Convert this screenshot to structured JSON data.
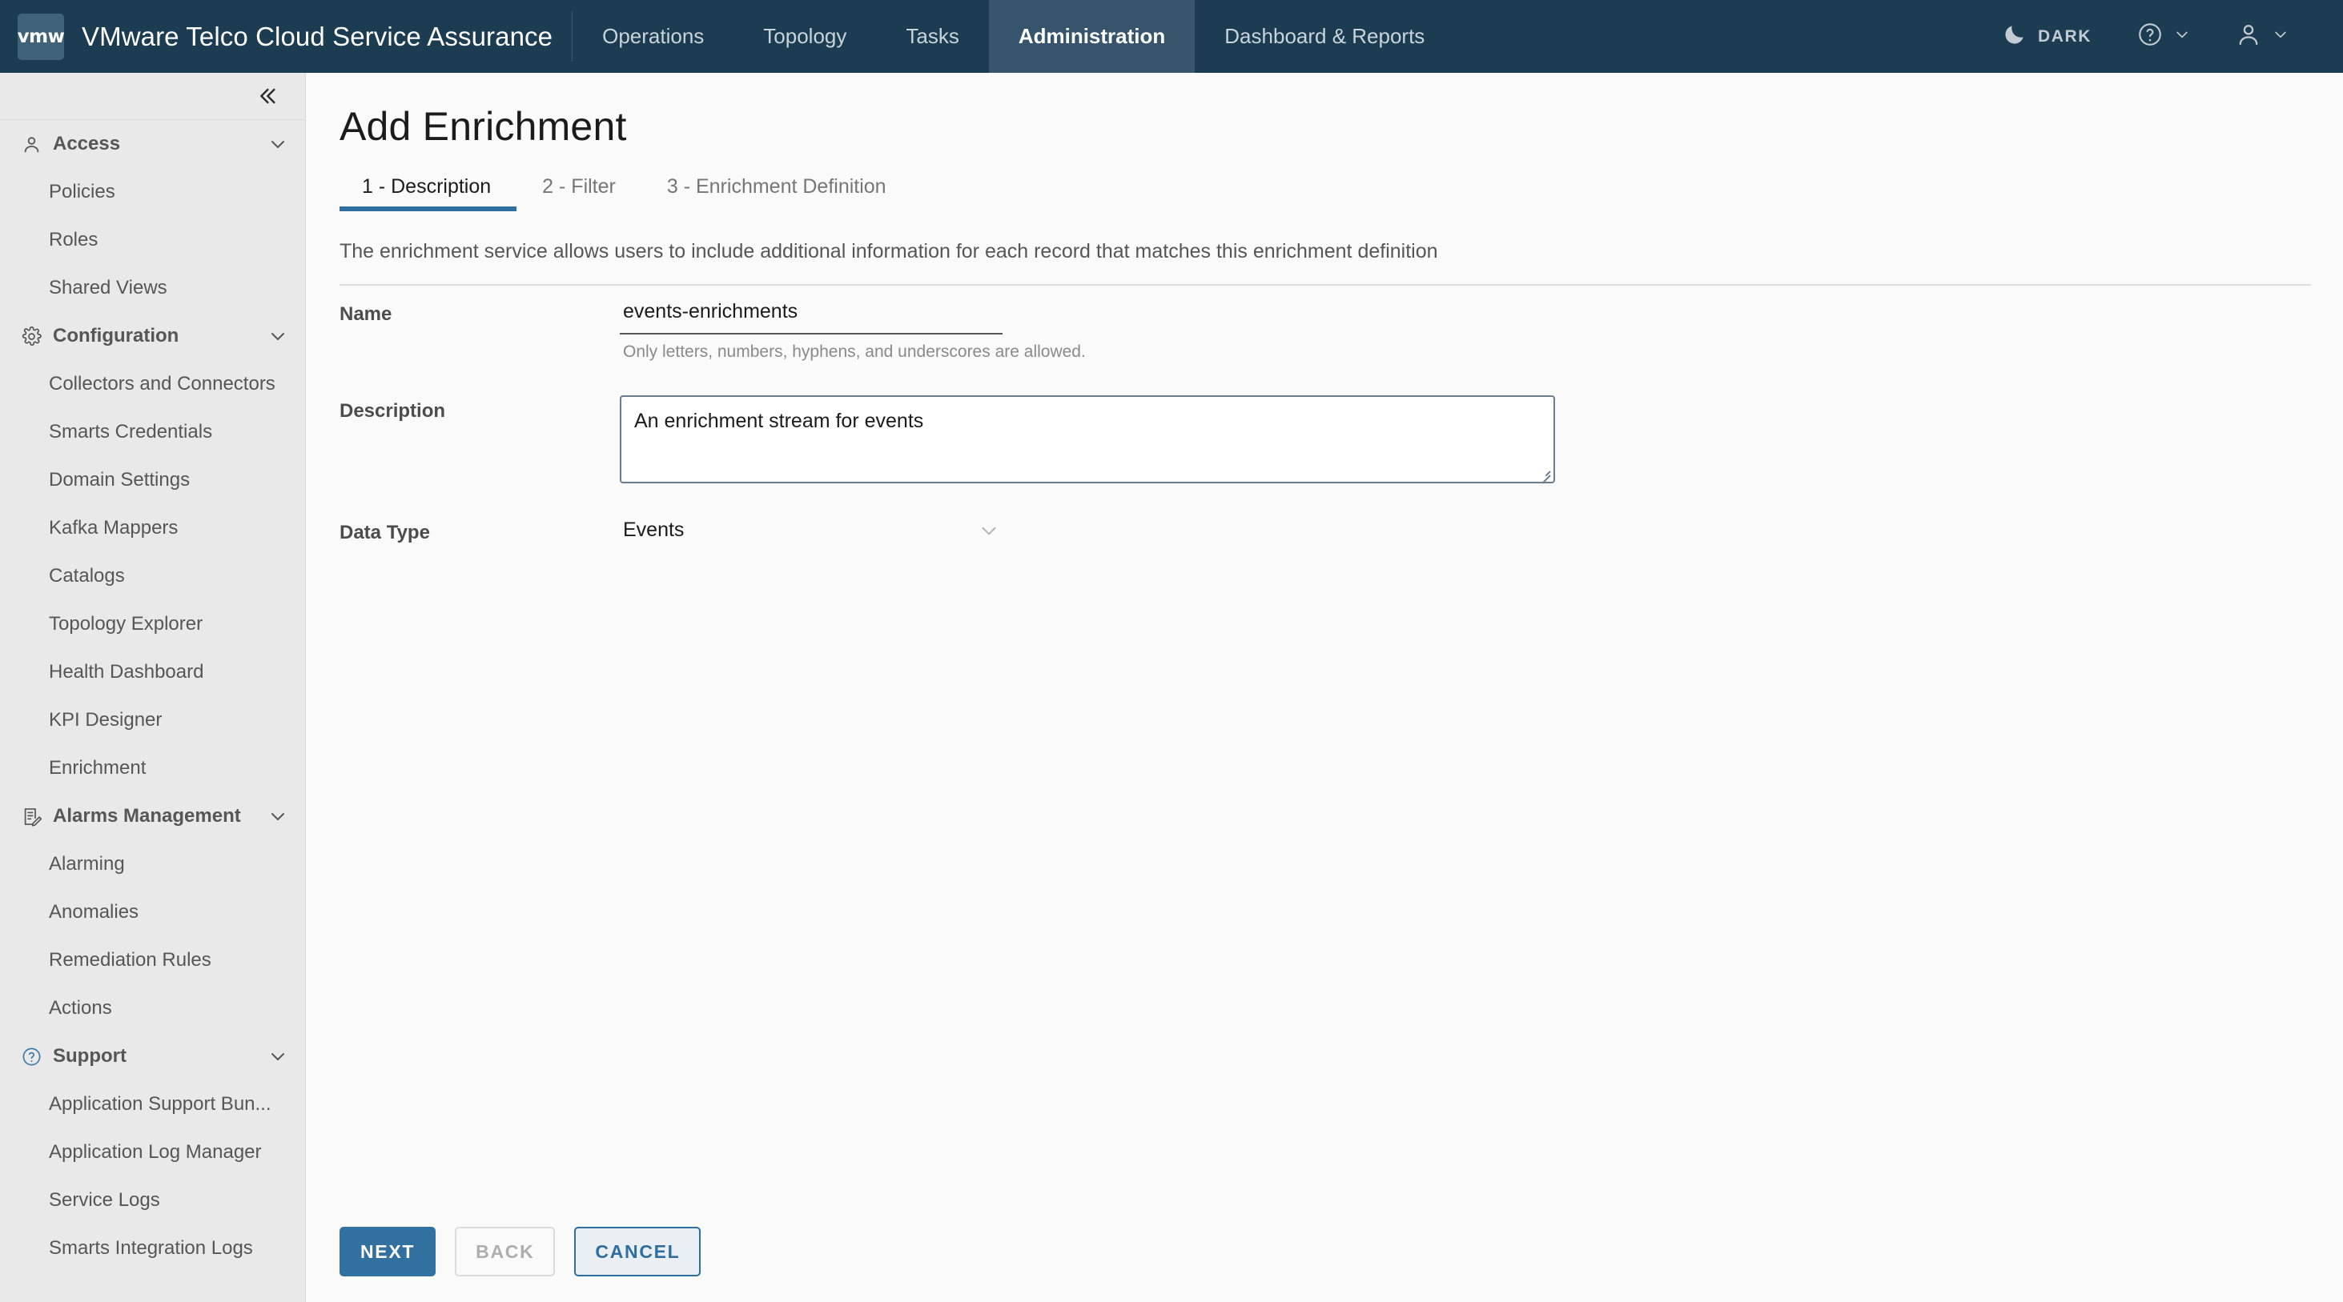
{
  "header": {
    "logo_text": "vmw",
    "title": "VMware Telco Cloud Service Assurance",
    "nav": [
      {
        "label": "Operations",
        "active": false
      },
      {
        "label": "Topology",
        "active": false
      },
      {
        "label": "Tasks",
        "active": false
      },
      {
        "label": "Administration",
        "active": true
      },
      {
        "label": "Dashboard & Reports",
        "active": false
      }
    ],
    "theme_toggle_label": "DARK",
    "theme_icon": "moon-icon",
    "help_icon": "question-circle-icon",
    "user_icon": "user-icon",
    "colors": {
      "bar": "#1b3c51",
      "active_tab": "#36546b"
    }
  },
  "sidebar": {
    "collapse_icon": "double-chevron-left-icon",
    "groups": [
      {
        "label": "Access",
        "icon": "user-icon",
        "expanded": true,
        "items": [
          "Policies",
          "Roles",
          "Shared Views"
        ]
      },
      {
        "label": "Configuration",
        "icon": "gear-icon",
        "expanded": true,
        "items": [
          "Collectors and Connectors",
          "Smarts Credentials",
          "Domain Settings",
          "Kafka Mappers",
          "Catalogs",
          "Topology Explorer",
          "Health Dashboard",
          "KPI Designer",
          "Enrichment"
        ]
      },
      {
        "label": "Alarms Management",
        "icon": "list-edit-icon",
        "expanded": true,
        "items": [
          "Alarming",
          "Anomalies",
          "Remediation Rules",
          "Actions"
        ]
      },
      {
        "label": "Support",
        "icon": "question-circle-icon",
        "expanded": true,
        "items": [
          "Application Support Bun...",
          "Application Log Manager",
          "Service Logs",
          "Smarts Integration Logs"
        ]
      }
    ]
  },
  "main": {
    "page_title": "Add Enrichment",
    "tabs": [
      {
        "label": "1 - Description",
        "active": true
      },
      {
        "label": "2 - Filter",
        "active": false
      },
      {
        "label": "3 - Enrichment Definition",
        "active": false
      }
    ],
    "intro_text": "The enrichment service allows users to include additional information for each record that matches this enrichment definition",
    "fields": {
      "name": {
        "label": "Name",
        "value": "events-enrichments",
        "placeholder": "",
        "helper": "Only letters, numbers, hyphens, and underscores are allowed."
      },
      "description": {
        "label": "Description",
        "value": "An enrichment stream for events",
        "placeholder": ""
      },
      "data_type": {
        "label": "Data Type",
        "value": "Events",
        "chevron_icon": "chevron-down-icon"
      }
    },
    "buttons": {
      "next": "NEXT",
      "back": "BACK",
      "cancel": "CANCEL"
    },
    "accent_color": "#2f6e9e"
  }
}
